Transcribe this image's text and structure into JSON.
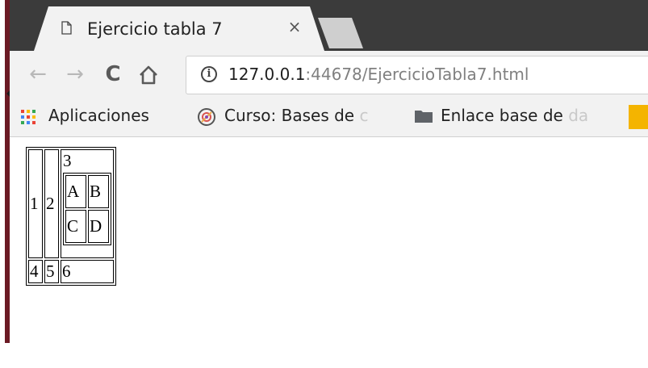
{
  "tab": {
    "title": "Ejercicio tabla 7",
    "close_glyph": "×",
    "icon": "document-icon"
  },
  "toolbar": {
    "back_glyph": "←",
    "forward_glyph": "→",
    "reload_glyph": "C",
    "home_icon": "home-icon",
    "info_glyph": "i",
    "url_host": "127.0.0.1",
    "url_rest": ":44678/EjercicioTabla7.html"
  },
  "bookmarks": {
    "apps": "Aplicaciones",
    "course_main": "Curso: Bases de ",
    "course_fade": "c",
    "link_main": "Enlace base de ",
    "link_fade": "da"
  },
  "table": {
    "cell1": "1",
    "cell2": "2",
    "cell3": "3",
    "inner": [
      "A",
      "B",
      "C",
      "D"
    ],
    "cell4": "4",
    "cell5": "5",
    "cell6": "6"
  },
  "colors": {
    "tabstrip": "#3b3b3b",
    "toolbar": "#f2f2f2",
    "left_edge": "#6b1a24",
    "bookmark_extra": "#f4b400"
  }
}
